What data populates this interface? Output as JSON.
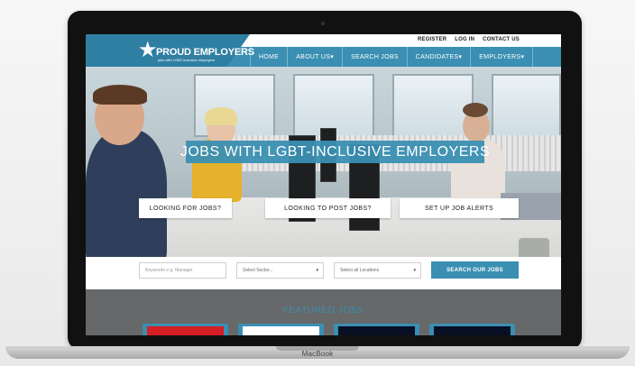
{
  "device": {
    "label": "MacBook"
  },
  "site": {
    "brand": {
      "name": "PROUD EMPLOYERS",
      "tagline": "jobs with LGBT-inclusive employers"
    },
    "toplinks": [
      "REGISTER",
      "LOG IN",
      "CONTACT US"
    ],
    "nav": [
      "HOME",
      "ABOUT US",
      "SEARCH JOBS",
      "CANDIDATES",
      "EMPLOYERS"
    ],
    "hero": {
      "title": "JOBS WITH LGBT-INCLUSIVE EMPLOYERS",
      "cta": [
        "LOOKING FOR JOBS?",
        "LOOKING TO POST JOBS?",
        "SET UP JOB ALERTS"
      ]
    },
    "search": {
      "keywords_placeholder": "Keywords e.g. Manager",
      "sector": "Select Sector...",
      "location": "Select all Locations",
      "button": "SEARCH OUR JOBS"
    },
    "featured": {
      "title": "FEATURED JOBS"
    },
    "colors": {
      "accent": "#3a8fb2",
      "logo_band": "#2f7fa3",
      "featured_bg": "#666869"
    }
  }
}
